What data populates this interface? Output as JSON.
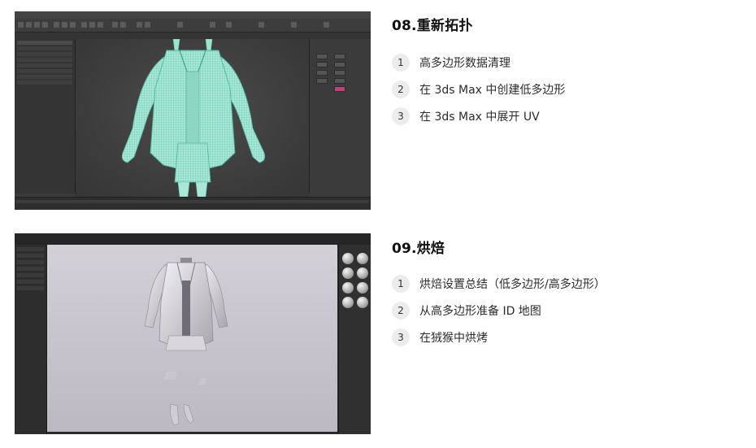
{
  "sections": [
    {
      "heading": "08.重新拓扑",
      "steps": [
        {
          "num": "1",
          "label": "高多边形数据清理"
        },
        {
          "num": "2",
          "label": "在 3ds Max 中创建低多边形"
        },
        {
          "num": "3",
          "label": "在 3ds Max 中展开 UV"
        }
      ]
    },
    {
      "heading": "09.烘焙",
      "steps": [
        {
          "num": "1",
          "label": "烘焙设置总结（低多边形/高多边形）"
        },
        {
          "num": "2",
          "label": "从高多边形准备 ID 地图"
        },
        {
          "num": "3",
          "label": "在狨猴中烘烤"
        }
      ]
    }
  ],
  "colors": {
    "mesh_wire": "#7ee0c4",
    "badge_bg": "#ececec",
    "viewport_light": "#d3d0d8"
  }
}
